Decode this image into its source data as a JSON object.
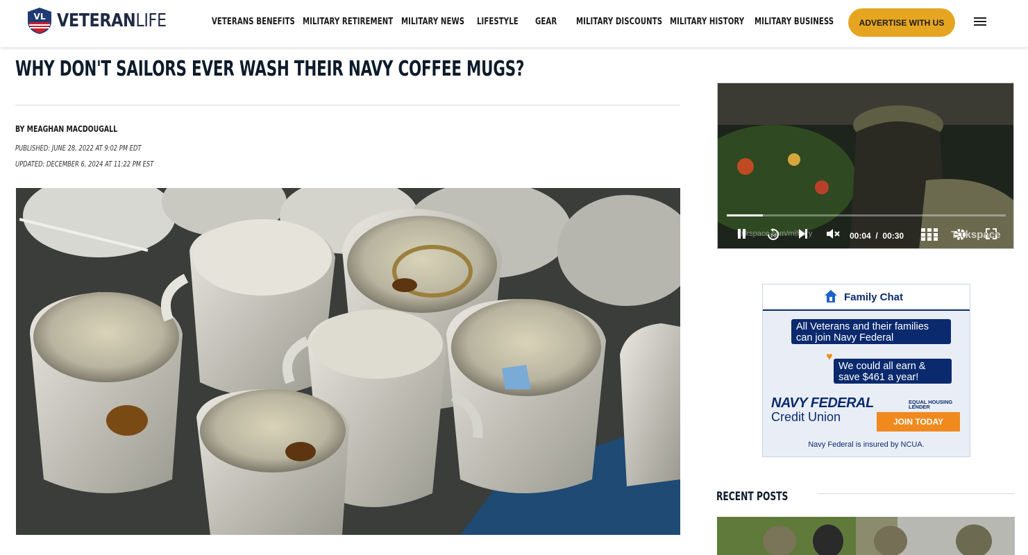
{
  "brand": {
    "badge_text": "VL",
    "name_bold": "VETERAN",
    "name_light": "LIFE"
  },
  "nav": {
    "items": [
      "VETERANS BENEFITS",
      "MILITARY RETIREMENT",
      "MILITARY NEWS",
      "LIFESTYLE",
      "GEAR",
      "MILITARY DISCOUNTS",
      "MILITARY HISTORY",
      "MILITARY BUSINESS"
    ],
    "advertise_label": "ADVERTISE WITH US",
    "menu_icon": "hamburger-icon"
  },
  "article": {
    "title": "WHY DON'T SAILORS EVER WASH THEIR NAVY COFFEE MUGS?",
    "byline_prefix": "BY",
    "author": "MEAGHAN MACDOUGALL",
    "published": "PUBLISHED: JUNE 28, 2022 AT 9:02 PM EDT",
    "updated": "UPDATED: DECEMBER 6, 2024 AT 11:22 PM EST"
  },
  "video": {
    "current_time": "00:04",
    "separator": "/",
    "duration": "00:30",
    "progress_fraction": 0.13,
    "watermark": "Talkspace",
    "caption": "talkspace.com/military",
    "icons": [
      "pause-icon",
      "replay-10-icon",
      "next-icon",
      "mute-icon",
      "grid-icon",
      "settings-icon",
      "fullscreen-icon"
    ]
  },
  "ad": {
    "header_title": "Family Chat",
    "bubble1": "All Veterans and their families can join Navy Federal",
    "bubble2": "We could all earn & save $461 a year!",
    "logo_line1": "NAVY FEDERAL",
    "logo_line2": "Credit Union",
    "ehl": "EQUAL HOUSING LENDER",
    "cta": "JOIN TODAY",
    "footer": "Navy Federal is insured by NCUA.",
    "colors": {
      "navy": "#0b2a6e",
      "orange": "#f08a1e"
    }
  },
  "sidebar": {
    "recent_posts_title": "RECENT POSTS"
  },
  "colors": {
    "accent": "#e6a521",
    "heading": "#0d1b2a"
  }
}
